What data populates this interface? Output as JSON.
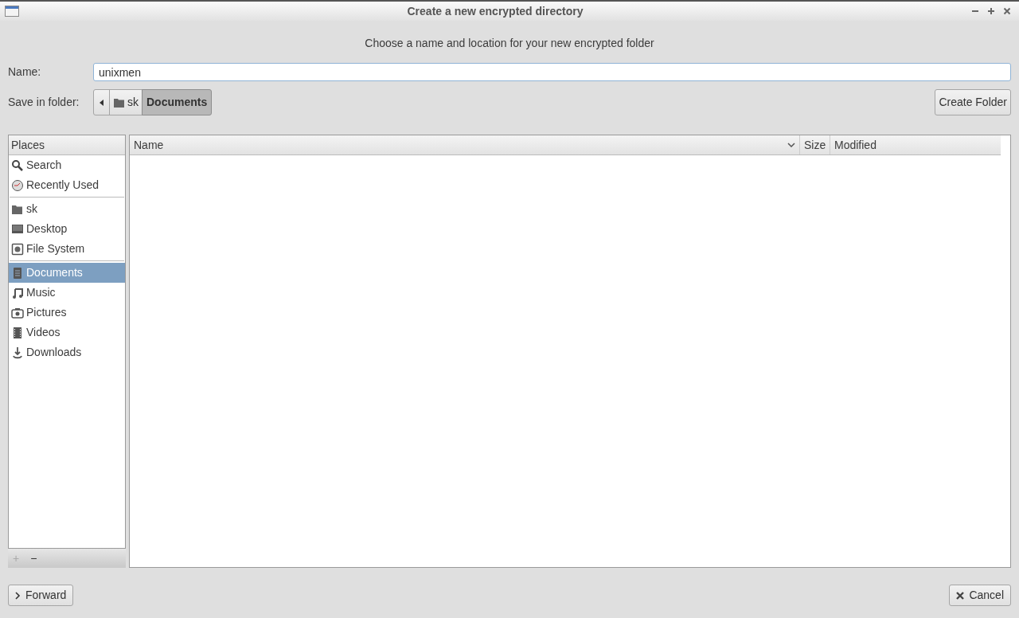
{
  "window": {
    "title": "Create a new encrypted directory"
  },
  "heading": "Choose a name and location for your new encrypted folder",
  "name_field": {
    "label": "Name:",
    "value": "unixmen"
  },
  "save_in": {
    "label": "Save in folder:",
    "path": [
      {
        "label": "sk",
        "kind": "folder",
        "selected": false
      },
      {
        "label": "Documents",
        "kind": "plain",
        "selected": true
      }
    ],
    "create_button": "Create Folder"
  },
  "places": {
    "header": "Places",
    "groups": [
      [
        {
          "label": "Search",
          "kind": "search",
          "selected": false
        },
        {
          "label": "Recently Used",
          "kind": "clock",
          "selected": false
        }
      ],
      [
        {
          "label": "sk",
          "kind": "folder",
          "selected": false
        },
        {
          "label": "Desktop",
          "kind": "desktop",
          "selected": false
        },
        {
          "label": "File System",
          "kind": "drive",
          "selected": false
        }
      ],
      [
        {
          "label": "Documents",
          "kind": "document",
          "selected": true
        },
        {
          "label": "Music",
          "kind": "music",
          "selected": false
        },
        {
          "label": "Pictures",
          "kind": "camera",
          "selected": false
        },
        {
          "label": "Videos",
          "kind": "film",
          "selected": false
        },
        {
          "label": "Downloads",
          "kind": "download",
          "selected": false
        }
      ]
    ],
    "add_button": {
      "label": "+",
      "disabled": true
    },
    "remove_button": {
      "label": "−",
      "disabled": false
    }
  },
  "file_list": {
    "columns": [
      "Name",
      "Size",
      "Modified"
    ]
  },
  "buttons": [
    "Forward",
    "Cancel"
  ]
}
